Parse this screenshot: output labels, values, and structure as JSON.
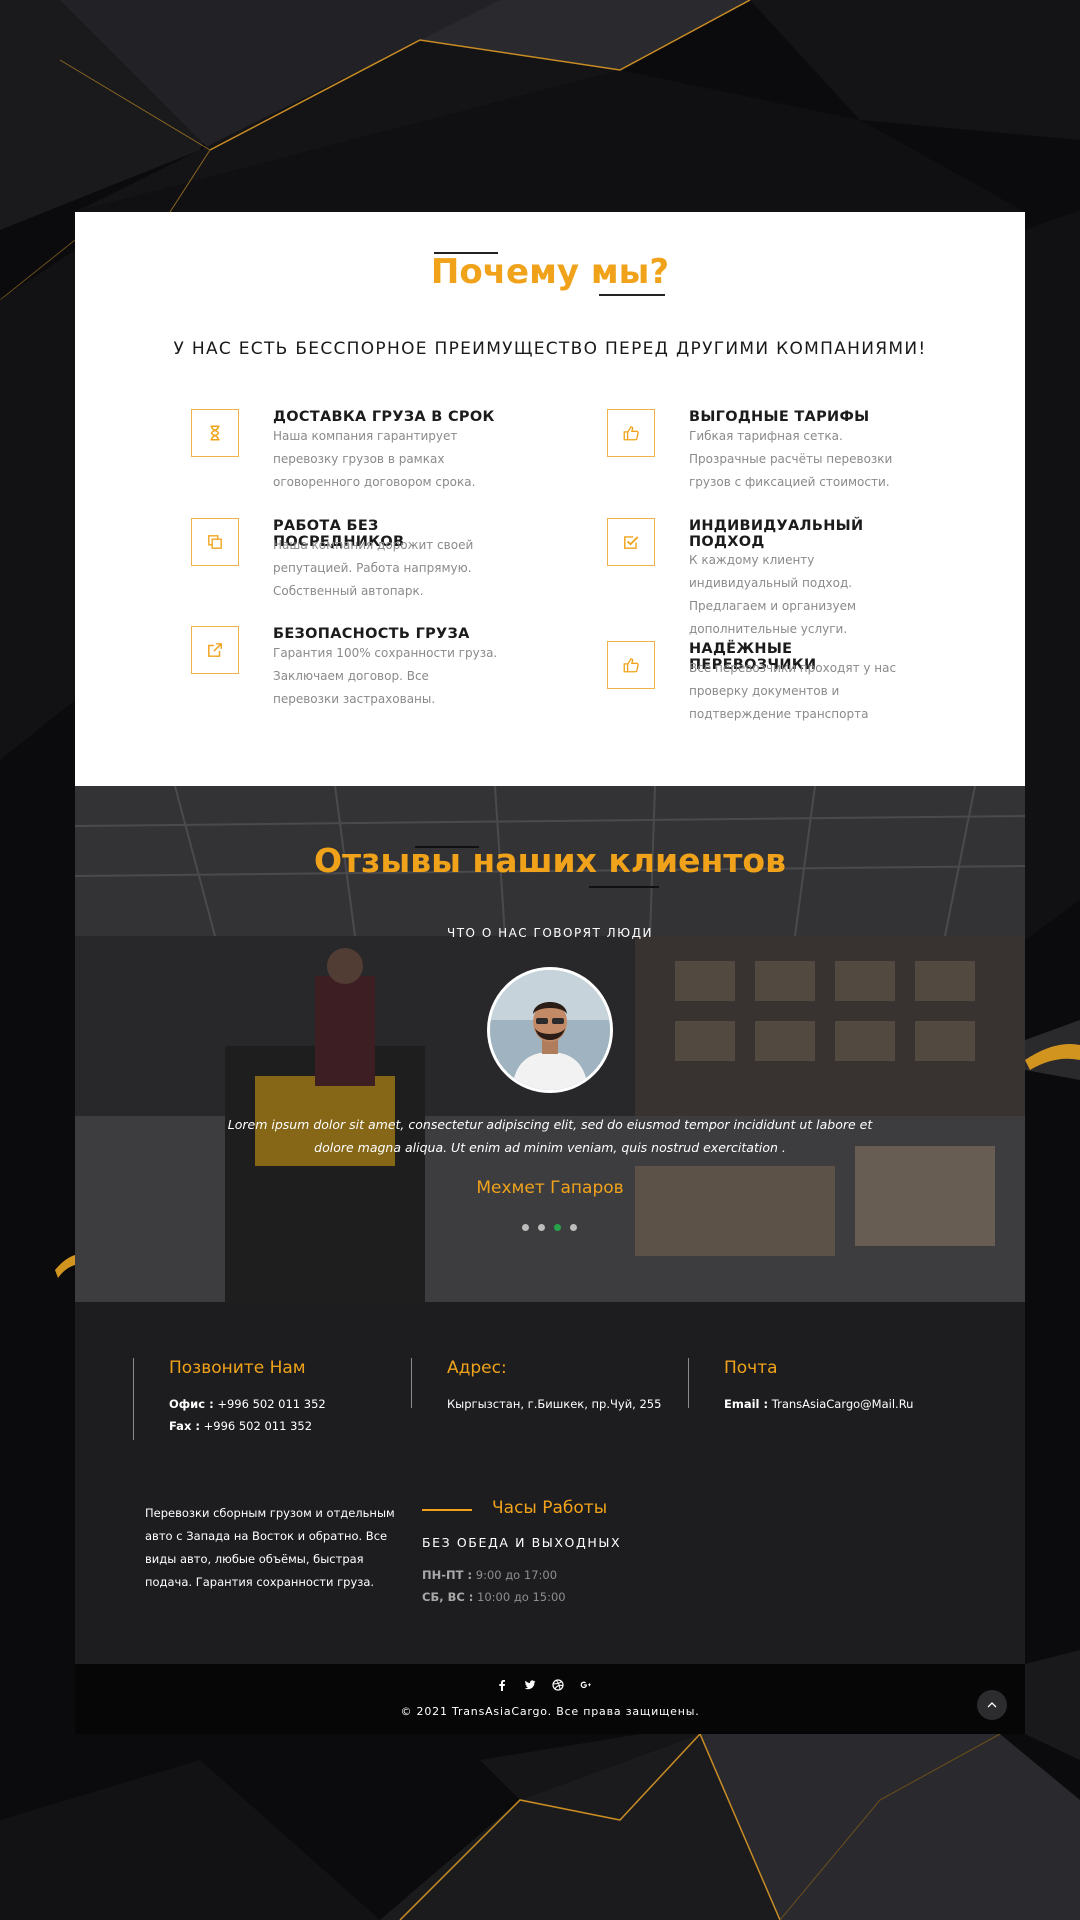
{
  "why": {
    "title": "Почему мы?",
    "subtitle": "У НАС ЕСТЬ БЕССПОРНОЕ ПРЕИМУЩЕСТВО ПЕРЕД ДРУГИМИ КОМПАНИЯМИ!",
    "features": [
      {
        "title": "ДОСТАВКА ГРУЗА В СРОК",
        "text": "Наша компания гарантирует перевозку грузов в рамках оговоренного договором срока.",
        "icon": "hourglass-icon"
      },
      {
        "title": "ВЫГОДНЫЕ ТАРИФЫ",
        "text": "Гибкая тарифная сетка. Прозрачные расчёты перевозки грузов с фиксацией стоимости.",
        "icon": "thumbs-up-icon"
      },
      {
        "title": "РАБОТА БЕЗ ПОСРЕДНИКОВ",
        "text": "Наша компания дорожит своей репутацией. Работа напрямую. Собственный автопарк.",
        "icon": "copy-icon"
      },
      {
        "title": "ИНДИВИДУАЛЬНЫЙ ПОДХОД",
        "text": "К каждому клиенту индивидуальный подход. Предлагаем и организуем дополнительные услуги.",
        "icon": "check-square-icon"
      },
      {
        "title": "БЕЗОПАСНОСТЬ ГРУЗА",
        "text": "Гарантия 100% сохранности груза. Заключаем договор. Все перевозки застрахованы.",
        "icon": "external-link-icon"
      },
      {
        "title": "НАДЁЖНЫЕ ПЕРЕВОЗЧИКИ",
        "text": "Все перевозчики проходят у нас проверку документов и подтверждение транспорта",
        "icon": "thumbs-up-icon"
      }
    ]
  },
  "reviews": {
    "title": "Отзывы наших клиентов",
    "subtitle": "ЧТО О НАС ГОВОРЯТ ЛЮДИ",
    "quote": "Lorem ipsum dolor sit amet, consectetur adipiscing elit, sed do eiusmod tempor incididunt ut labore et dolore magna aliqua. Ut enim ad minim veniam, quis nostrud exercitation .",
    "name": "Мехмет Гапаров",
    "slide_count": 4,
    "active_slide": 3
  },
  "footer": {
    "phone": {
      "head": "Позвоните Нам",
      "office_label": "Офис :",
      "office": "+996 502 011 352",
      "fax_label": "Fax :",
      "fax": "+996 502 011 352"
    },
    "address": {
      "head": "Адрес:",
      "value": "Кыргызстан, г.Бишкек, пр.Чуй, 255"
    },
    "mail": {
      "head": "Почта",
      "label": "Email :",
      "value": "TransAsiaCargo@Mail.Ru"
    },
    "about": "Перевозки сборным грузом и отдельным авто с Запада на Восток и обратно. Все виды авто, любые объёмы, быстрая подача. Гарантия сохранности груза.",
    "hours": {
      "head": "Часы Работы",
      "sub": "БЕЗ ОБЕДА И ВЫХОДНЫХ",
      "weekdays_label": "ПН-ПТ :",
      "weekdays": "9:00 до 17:00",
      "weekend_label": "СБ, ВС :",
      "weekend": "10:00 до 15:00"
    },
    "socials": [
      "facebook-icon",
      "twitter-icon",
      "dribbble-icon",
      "google-plus-icon"
    ],
    "copyright": "© 2021 TransAsiaCargo. Все права защищены."
  },
  "colors": {
    "accent": "#f0a31a",
    "dark": "#1d1d1f",
    "active_dot": "#27a34a"
  }
}
